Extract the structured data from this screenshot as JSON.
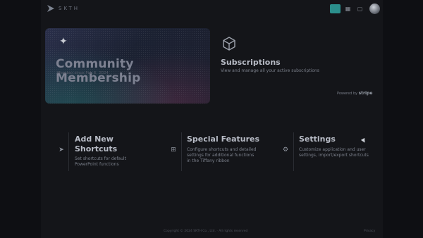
{
  "header": {
    "brand": "SKTH",
    "icons": [
      "app-logo-icon",
      "active-toolbar-icon",
      "grid-icon",
      "list-icon",
      "avatar"
    ],
    "accent_color": "#2b8f8c"
  },
  "membership": {
    "title": "Community Membership",
    "subtitle": "Member since Feb 6, 2024"
  },
  "subscriptions": {
    "title": "Subscriptions",
    "description": "View and manage all your active subscriptions",
    "powered_by": "Powered by",
    "provider": "stripe"
  },
  "features": [
    {
      "title_1": "Add New",
      "title_2": "Shortcuts",
      "desc_1": "Set shortcuts for default",
      "desc_2": "PowerPoint functions",
      "icon": "arrow-icon"
    },
    {
      "title_1": "Special Features",
      "desc_1": "Configure shortcuts and detailed",
      "desc_2": "settings for additional functions",
      "desc_3": "in the Tiffany ribbon",
      "icon": "puzzle-icon"
    },
    {
      "title_1": "Settings",
      "desc_1": "Customize application and user",
      "desc_2": "settings, import/export shortcuts",
      "icon": "gear-icon"
    }
  ],
  "footer": {
    "copyright": "Copyright © 2024 SKTH Co., Ltd. · All rights reserved",
    "privacy": "Privacy"
  }
}
